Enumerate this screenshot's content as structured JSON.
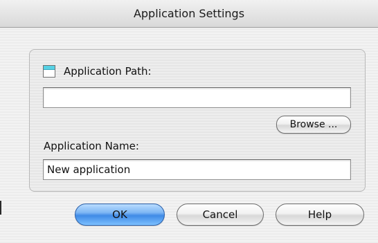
{
  "window": {
    "title": "Application Settings"
  },
  "path_section": {
    "label": "Application Path:",
    "checkbox_checked": false,
    "value": "",
    "browse_label": "Browse ..."
  },
  "name_section": {
    "label": "Application Name:",
    "value": "New application"
  },
  "buttons": {
    "ok": "OK",
    "cancel": "Cancel",
    "help": "Help"
  },
  "colors": {
    "default_button": "#4a92e8",
    "checkbox_accent": "#56d1e4"
  }
}
